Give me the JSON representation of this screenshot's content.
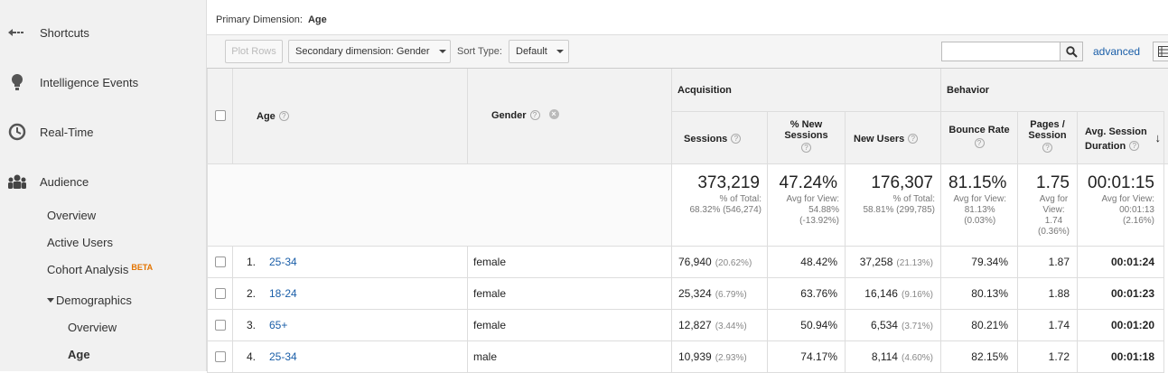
{
  "sidebar": {
    "shortcuts": "Shortcuts",
    "intelligence": "Intelligence Events",
    "realtime": "Real-Time",
    "audience": "Audience",
    "overview": "Overview",
    "active_users": "Active Users",
    "cohort": "Cohort Analysis",
    "beta": "BETA",
    "demographics": "Demographics",
    "demo_overview": "Overview",
    "age": "Age"
  },
  "header": {
    "primary_label": "Primary Dimension:",
    "primary_value": "Age"
  },
  "toolbar": {
    "plot_rows": "Plot Rows",
    "secondary": "Secondary dimension: Gender",
    "sort_label": "Sort Type:",
    "sort_value": "Default",
    "search_value": "",
    "advanced": "advanced"
  },
  "table": {
    "groups": {
      "acquisition": "Acquisition",
      "behavior": "Behavior"
    },
    "headers": {
      "age": "Age",
      "gender": "Gender",
      "sessions": "Sessions",
      "new_sessions_1": "% New",
      "new_sessions_2": "Sessions",
      "new_users": "New Users",
      "bounce_rate": "Bounce Rate",
      "pages_1": "Pages /",
      "pages_2": "Session",
      "duration_1": "Avg. Session",
      "duration_2": "Duration"
    },
    "totals": {
      "sessions": "373,219",
      "sessions_sub1": "% of Total:",
      "sessions_sub2": "68.32% (546,274)",
      "new_sessions": "47.24%",
      "new_sessions_sub1": "Avg for View:",
      "new_sessions_sub2": "54.88%",
      "new_sessions_sub3": "(-13.92%)",
      "new_users": "176,307",
      "new_users_sub1": "% of Total:",
      "new_users_sub2": "58.81% (299,785)",
      "bounce": "81.15%",
      "bounce_sub1": "Avg for View:",
      "bounce_sub2": "81.13%",
      "bounce_sub3": "(0.03%)",
      "pages": "1.75",
      "pages_sub1": "Avg for",
      "pages_sub2": "View:",
      "pages_sub3": "1.74",
      "pages_sub4": "(0.36%)",
      "duration": "00:01:15",
      "duration_sub1": "Avg for View:",
      "duration_sub2": "00:01:13",
      "duration_sub3": "(2.16%)"
    },
    "rows": [
      {
        "num": "1.",
        "age": "25-34",
        "gender": "female",
        "sessions": "76,940",
        "sessions_pct": "(20.62%)",
        "new_sessions": "48.42%",
        "new_users": "37,258",
        "new_users_pct": "(21.13%)",
        "bounce": "79.34%",
        "pages": "1.87",
        "duration": "00:01:24"
      },
      {
        "num": "2.",
        "age": "18-24",
        "gender": "female",
        "sessions": "25,324",
        "sessions_pct": "(6.79%)",
        "new_sessions": "63.76%",
        "new_users": "16,146",
        "new_users_pct": "(9.16%)",
        "bounce": "80.13%",
        "pages": "1.88",
        "duration": "00:01:23"
      },
      {
        "num": "3.",
        "age": "65+",
        "gender": "female",
        "sessions": "12,827",
        "sessions_pct": "(3.44%)",
        "new_sessions": "50.94%",
        "new_users": "6,534",
        "new_users_pct": "(3.71%)",
        "bounce": "80.21%",
        "pages": "1.74",
        "duration": "00:01:20"
      },
      {
        "num": "4.",
        "age": "25-34",
        "gender": "male",
        "sessions": "10,939",
        "sessions_pct": "(2.93%)",
        "new_sessions": "74.17%",
        "new_users": "8,114",
        "new_users_pct": "(4.60%)",
        "bounce": "82.15%",
        "pages": "1.72",
        "duration": "00:01:18"
      }
    ]
  }
}
